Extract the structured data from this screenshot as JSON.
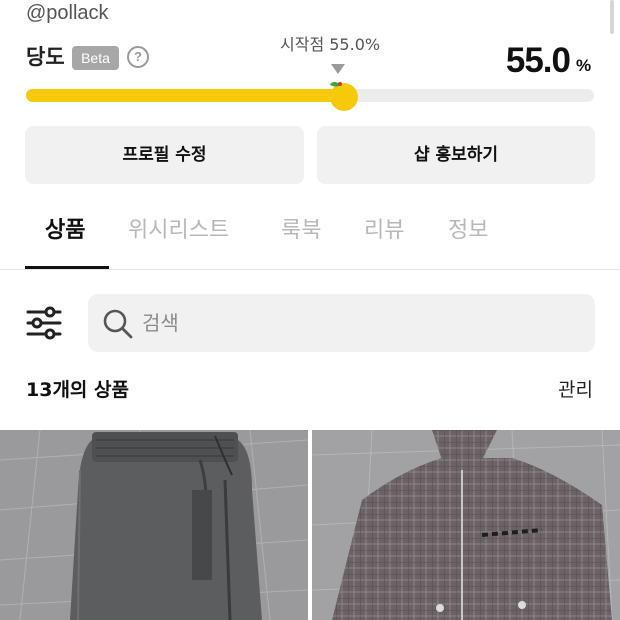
{
  "profile": {
    "username": "@pollack"
  },
  "sweetness": {
    "label": "당도",
    "badge": "Beta",
    "help_icon": "question-circle-icon",
    "start_label": "시작점 55.0%",
    "value": "55.0",
    "unit": "%",
    "level_percent": 55.0,
    "accent_color": "#f6c90a"
  },
  "actions": {
    "edit_profile": "프로필 수정",
    "promote_shop": "샵 홍보하기"
  },
  "tabs": [
    {
      "label": "상품",
      "active": true
    },
    {
      "label": "위시리스트",
      "active": false
    },
    {
      "label": "룩북",
      "active": false
    },
    {
      "label": "리뷰",
      "active": false
    },
    {
      "label": "정보",
      "active": false
    }
  ],
  "search": {
    "placeholder": "검색",
    "filter_icon": "sliders-icon",
    "search_icon": "magnifier-icon"
  },
  "products": {
    "count_number": "13",
    "count_suffix": "개의 상품",
    "manage_label": "관리",
    "items": [
      {
        "image": "gray-track-pants-photo"
      },
      {
        "image": "plaid-zip-jacket-photo"
      }
    ]
  }
}
